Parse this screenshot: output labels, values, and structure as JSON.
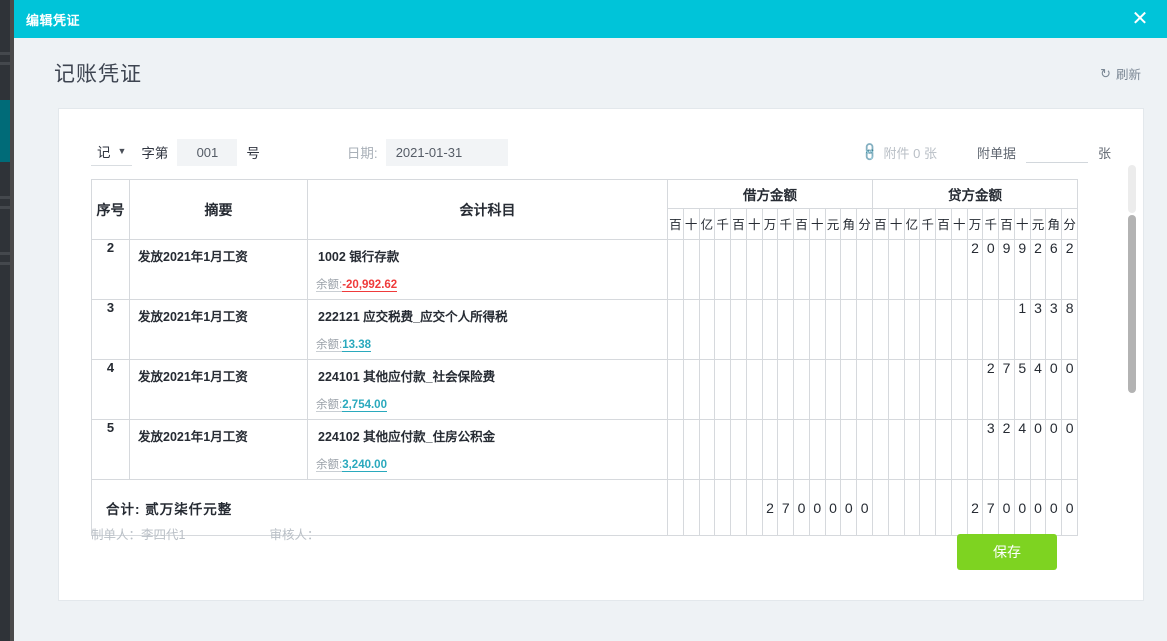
{
  "window": {
    "title": "编辑凭证",
    "close_icon": "close-icon",
    "accent": "#00c4d9"
  },
  "page": {
    "title": "记账凭证",
    "refresh_label": "刷新",
    "refresh_icon": "refresh-icon"
  },
  "form": {
    "kind_value": "记",
    "kind_caret": "chevron-down-icon",
    "word_label": "字第",
    "number_value": "001",
    "number_placeholder": "",
    "hao_label": "号",
    "date_label": "日期:",
    "date_value": "2021-01-31",
    "date_placeholder": "",
    "attach_icon": "paperclip-icon",
    "attach_text": "附件 0 张",
    "attach_doc_label": "附单据",
    "attach_doc_value": "",
    "attach_doc_placeholder": "",
    "attach_doc_unit": "张"
  },
  "table": {
    "headers": {
      "no": "序号",
      "summary": "摘要",
      "account": "会计科目",
      "debit": "借方金额",
      "credit": "贷方金额"
    },
    "digit_headers": [
      "百",
      "十",
      "亿",
      "千",
      "百",
      "十",
      "万",
      "千",
      "百",
      "十",
      "元",
      "角",
      "分"
    ],
    "rows": [
      {
        "no": "2",
        "summary": "发放2021年1月工资",
        "account": "1002 银行存款",
        "balance_label": "余额:",
        "balance_value": "-20,992.62",
        "balance_sign": "negative",
        "debit_digits": [
          "",
          "",
          "",
          "",
          "",
          "",
          "",
          "",
          "",
          "",
          "",
          "",
          ""
        ],
        "credit_digits": [
          "",
          "",
          "",
          "",
          "",
          "",
          "2",
          "0",
          "9",
          "9",
          "2",
          "6",
          "2"
        ]
      },
      {
        "no": "3",
        "summary": "发放2021年1月工资",
        "account": "222121 应交税费_应交个人所得税",
        "balance_label": "余额:",
        "balance_value": "13.38",
        "balance_sign": "positive",
        "debit_digits": [
          "",
          "",
          "",
          "",
          "",
          "",
          "",
          "",
          "",
          "",
          "",
          "",
          ""
        ],
        "credit_digits": [
          "",
          "",
          "",
          "",
          "",
          "",
          "",
          "",
          "",
          "1",
          "3",
          "3",
          "8"
        ]
      },
      {
        "no": "4",
        "summary": "发放2021年1月工资",
        "account": "224101 其他应付款_社会保险费",
        "balance_label": "余额:",
        "balance_value": "2,754.00",
        "balance_sign": "positive",
        "debit_digits": [
          "",
          "",
          "",
          "",
          "",
          "",
          "",
          "",
          "",
          "",
          "",
          "",
          ""
        ],
        "credit_digits": [
          "",
          "",
          "",
          "",
          "",
          "",
          "",
          "2",
          "7",
          "5",
          "4",
          "0",
          "0"
        ]
      },
      {
        "no": "5",
        "summary": "发放2021年1月工资",
        "account": "224102 其他应付款_住房公积金",
        "balance_label": "余额:",
        "balance_value": "3,240.00",
        "balance_sign": "positive",
        "debit_digits": [
          "",
          "",
          "",
          "",
          "",
          "",
          "",
          "",
          "",
          "",
          "",
          "",
          ""
        ],
        "credit_digits": [
          "",
          "",
          "",
          "",
          "",
          "",
          "",
          "3",
          "2",
          "4",
          "0",
          "0",
          "0"
        ]
      }
    ],
    "total": {
      "label": "合计:  贰万柒仟元整",
      "debit_digits": [
        "",
        "",
        "",
        "",
        "",
        "",
        "2",
        "7",
        "0",
        "0",
        "0",
        "0",
        "0"
      ],
      "credit_digits": [
        "",
        "",
        "",
        "",
        "",
        "",
        "2",
        "7",
        "0",
        "0",
        "0",
        "0",
        "0"
      ]
    }
  },
  "footer": {
    "preparer_label": "制单人：",
    "preparer_value": "李四代1",
    "reviewer_label": "审核人：",
    "reviewer_value": "",
    "save_label": "保存",
    "save_color": "#7ed321"
  }
}
